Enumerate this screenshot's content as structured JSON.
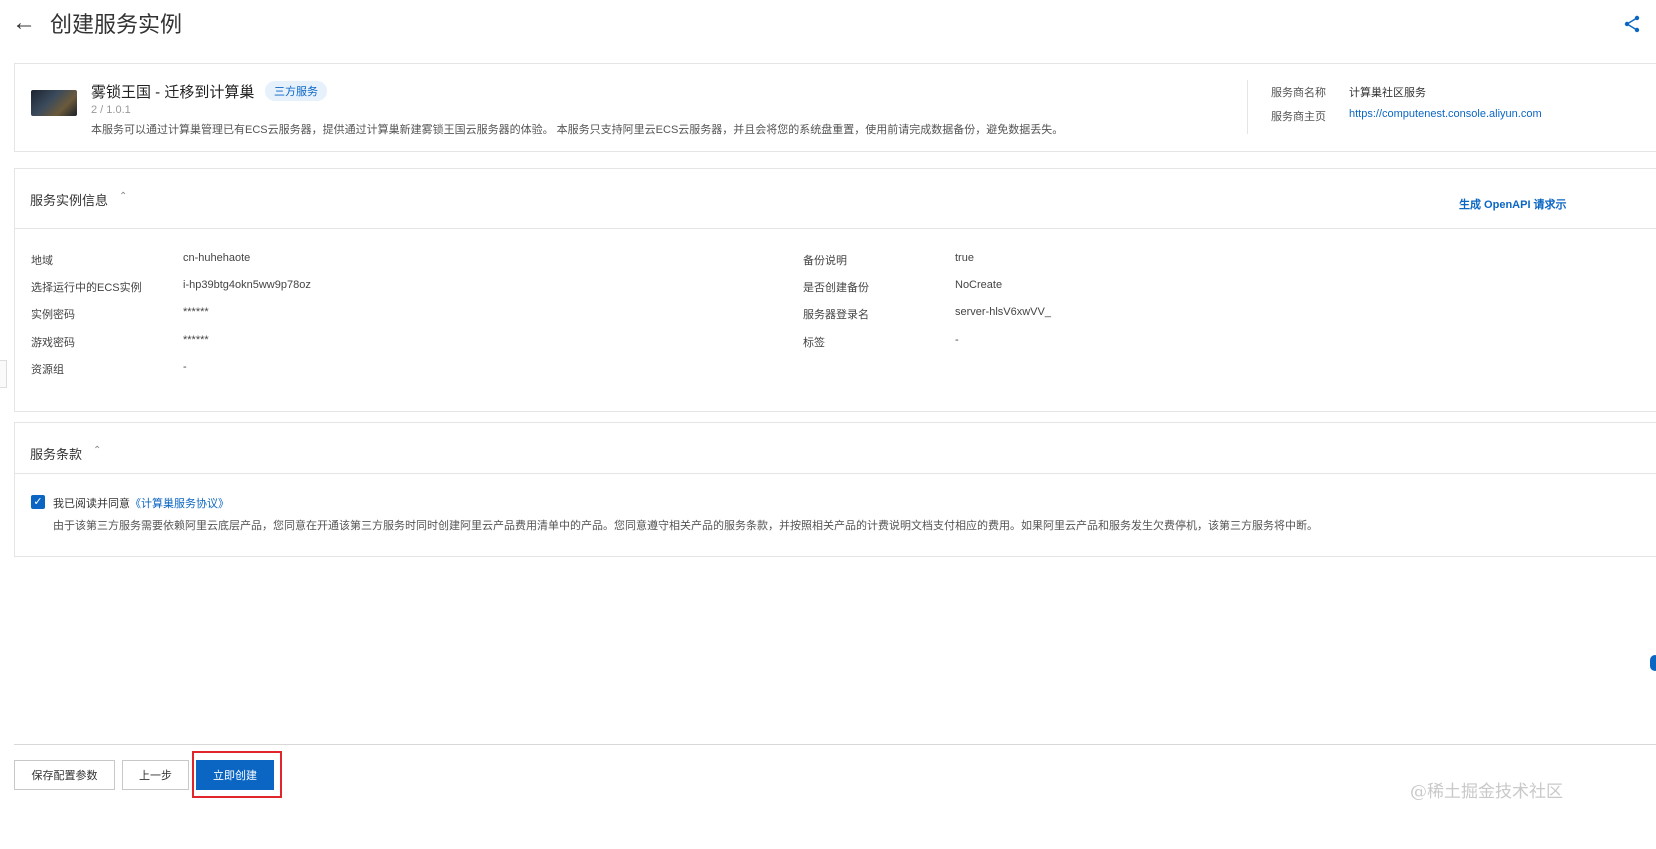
{
  "header": {
    "back_icon": "arrow-left-icon",
    "title": "创建服务实例",
    "share_icon": "share-icon"
  },
  "service": {
    "name": "雾锁王国 - 迁移到计算巢",
    "badge": "三方服务",
    "version": "2 / 1.0.1",
    "description": "本服务可以通过计算巢管理已有ECS云服务器，提供通过计算巢新建雾锁王国云服务器的体验。 本服务只支持阿里云ECS云服务器，并且会将您的系统盘重置，使用前请完成数据备份，避免数据丢失。",
    "provider_name_label": "服务商名称",
    "provider_name": "计算巢社区服务",
    "provider_home_label": "服务商主页",
    "provider_home": "https://computenest.console.aliyun.com"
  },
  "instance_info": {
    "title": "服务实例信息",
    "openapi_link": "生成 OpenAPI 请求示",
    "left": [
      {
        "label": "地域",
        "value": "cn-huhehaote"
      },
      {
        "label": "选择运行中的ECS实例",
        "value": "i-hp39btg4okn5ww9p78oz"
      },
      {
        "label": "实例密码",
        "value": "******"
      },
      {
        "label": "游戏密码",
        "value": "******"
      },
      {
        "label": "资源组",
        "value": "-"
      }
    ],
    "right": [
      {
        "label": "备份说明",
        "value": "true"
      },
      {
        "label": "是否创建备份",
        "value": "NoCreate"
      },
      {
        "label": "服务器登录名",
        "value": "server-hlsV6xwVV_"
      },
      {
        "label": "标签",
        "value": "-"
      }
    ]
  },
  "terms": {
    "title": "服务条款",
    "checkbox_checked": true,
    "agree_prefix": "我已阅读并同意",
    "agree_link": "《计算巢服务协议》",
    "note": "由于该第三方服务需要依赖阿里云底层产品，您同意在开通该第三方服务时同时创建阿里云产品费用清单中的产品。您同意遵守相关产品的服务条款，并按照相关产品的计费说明文档支付相应的费用。如果阿里云产品和服务发生欠费停机，该第三方服务将中断。"
  },
  "footer": {
    "save_label": "保存配置参数",
    "prev_label": "上一步",
    "create_label": "立即创建"
  },
  "watermark": "@稀土掘金技术社区",
  "colors": {
    "accent": "#0b66c3",
    "highlight": "#e0262b"
  }
}
